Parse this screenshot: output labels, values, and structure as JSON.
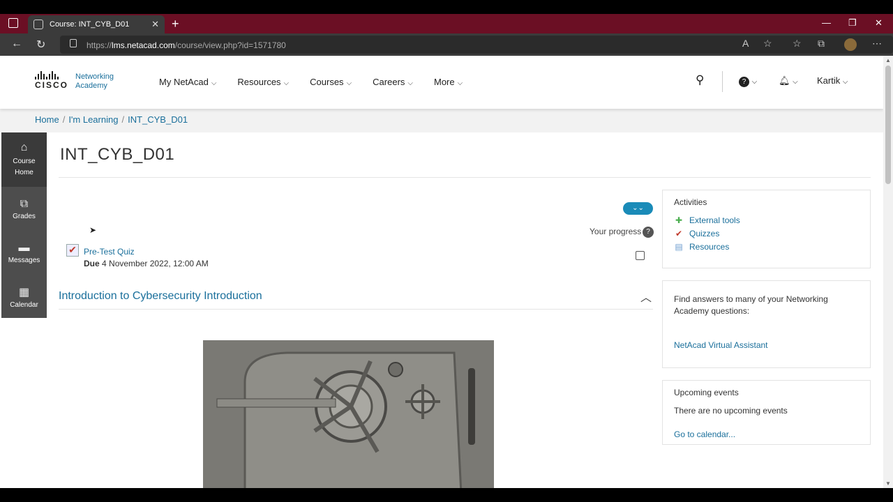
{
  "browser": {
    "tab_title": "Course: INT_CYB_D01",
    "url_prefix": "https://",
    "url_host": "lms.netacad.com",
    "url_path": "/course/view.php?id=1571780"
  },
  "header": {
    "logo_brand": "CISCO",
    "logo_line1": "Networking",
    "logo_line2": "Academy",
    "nav": [
      "My NetAcad",
      "Resources",
      "Courses",
      "Careers",
      "More"
    ],
    "user": "Kartik"
  },
  "breadcrumb": {
    "items": [
      "Home",
      "I'm Learning",
      "INT_CYB_D01"
    ]
  },
  "sidebar": {
    "items": [
      {
        "icon": "home-icon",
        "label": "Course Home"
      },
      {
        "icon": "grades-icon",
        "label": "Grades"
      },
      {
        "icon": "messages-icon",
        "label": "Messages"
      },
      {
        "icon": "calendar-icon",
        "label": "Calendar"
      }
    ]
  },
  "main": {
    "course_title": "INT_CYB_D01",
    "progress_label": "Your progress",
    "quiz": {
      "name": "Pre-Test Quiz",
      "due_label": "Due",
      "due_date": "4 November 2022, 12:00 AM"
    },
    "section_title": "Introduction to Cybersecurity Introduction"
  },
  "right": {
    "activities": {
      "heading": "Activities",
      "items": [
        "External tools",
        "Quizzes",
        "Resources"
      ]
    },
    "help": {
      "text": "Find answers to many of your Networking Academy questions:",
      "link": "NetAcad Virtual Assistant"
    },
    "events": {
      "heading": "Upcoming events",
      "empty_text": "There are no upcoming events",
      "link": "Go to calendar..."
    }
  },
  "colors": {
    "accent": "#1a6f9b",
    "tabbar": "#6b0f24",
    "sidebar": "#4d4d4d"
  }
}
